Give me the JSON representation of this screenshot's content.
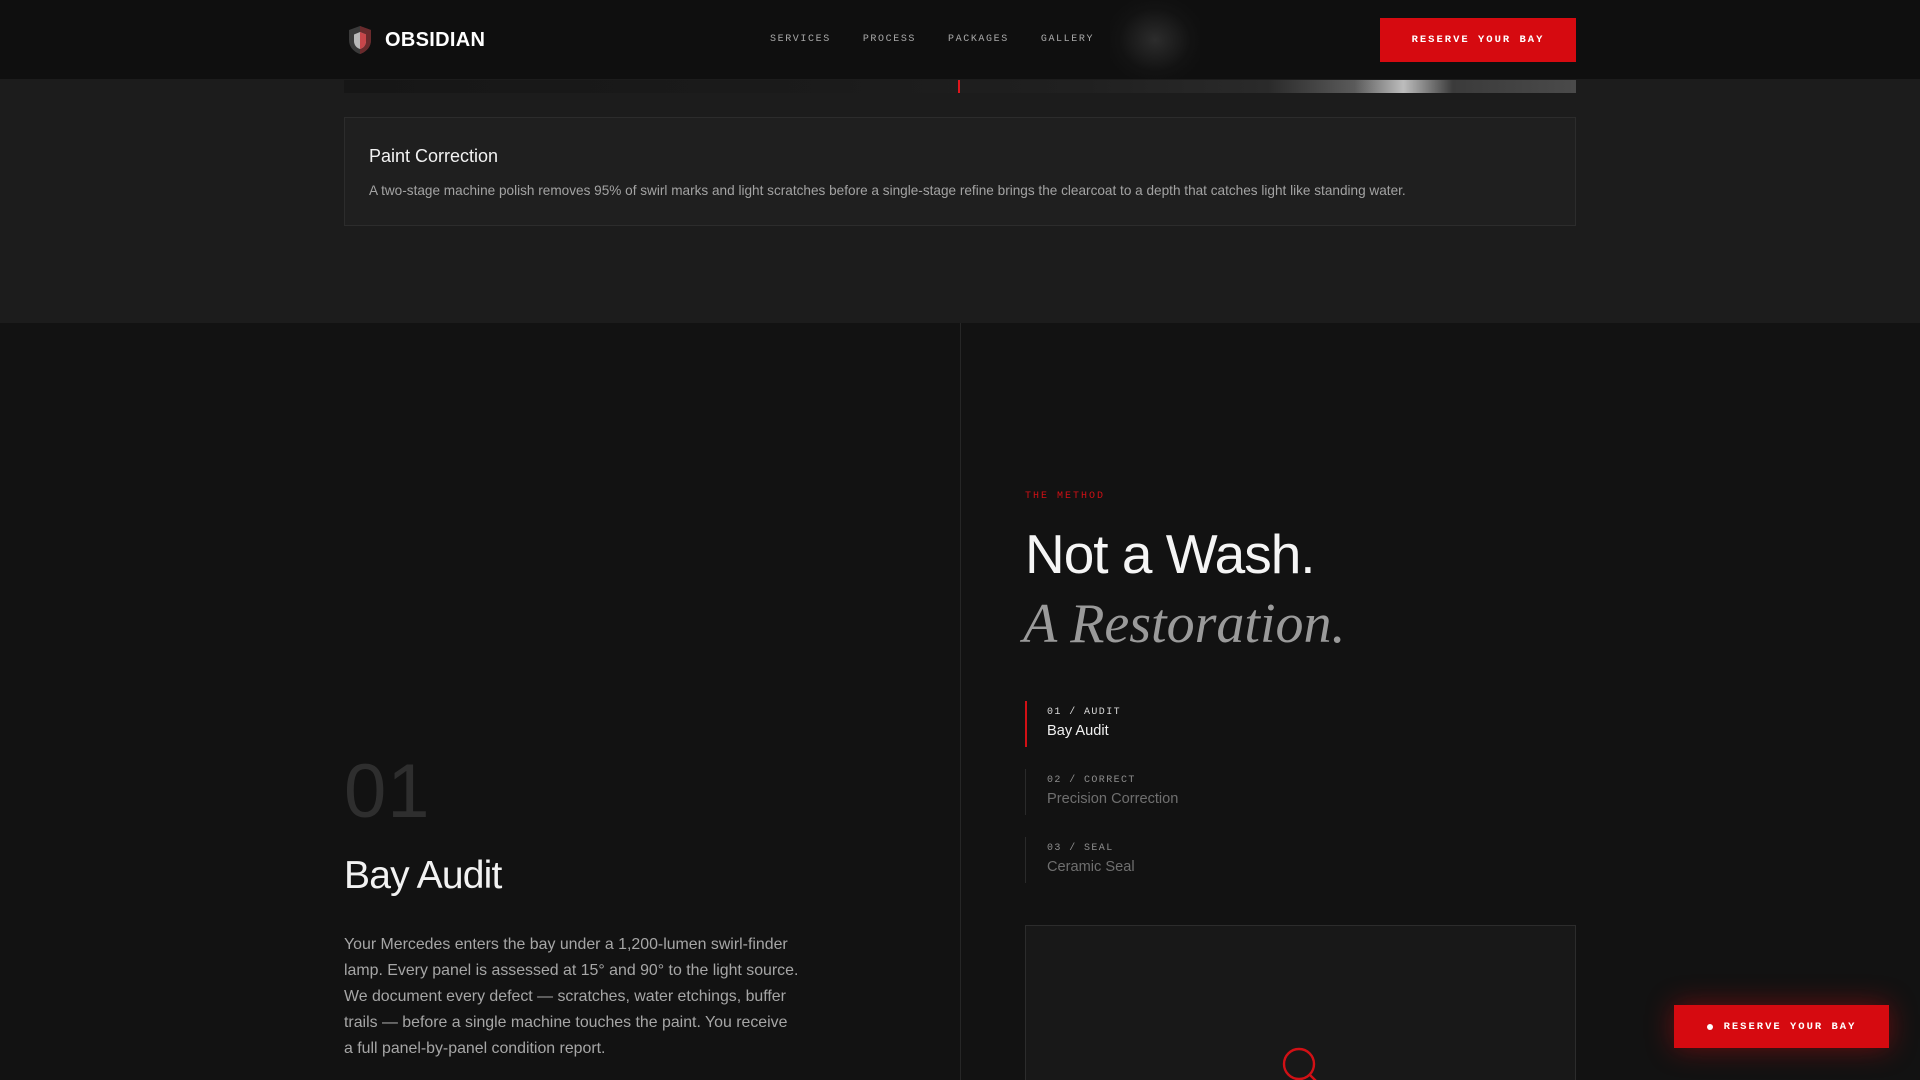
{
  "brand": {
    "name": "OBSIDIAN",
    "logo_icon": "shield-icon"
  },
  "nav": {
    "items": [
      {
        "label": "SERVICES"
      },
      {
        "label": "PROCESS"
      },
      {
        "label": "PACKAGES"
      },
      {
        "label": "GALLERY"
      }
    ],
    "cta_label": "RESERVE YOUR BAY"
  },
  "service": {
    "title": "Paint Correction",
    "description": "A two-stage machine polish removes 95% of swirl marks and light scratches before a single-stage refine brings the clearcoat to a depth that catches light like standing water."
  },
  "method": {
    "eyebrow": "THE METHOD",
    "headline_line1": "Not a Wash.",
    "headline_line2": "A Restoration.",
    "steps": [
      {
        "tag": "01 / AUDIT",
        "label": "Bay Audit",
        "active": true
      },
      {
        "tag": "02 / CORRECT",
        "label": "Precision Correction",
        "active": false
      },
      {
        "tag": "03 / SEAL",
        "label": "Ceramic Seal",
        "active": false
      }
    ],
    "preview_icon": "magnifier-icon"
  },
  "active_step": {
    "number": "01",
    "title": "Bay Audit",
    "body": "Your Mercedes enters the bay under a 1,200-lumen swirl-finder lamp. Every panel is assessed at 15° and 90° to the light source. We document every defect — scratches, water etchings, buffer trails — before a single machine touches the paint. You receive a full panel-by-panel condition report."
  },
  "floating_cta": {
    "label": "RESERVE YOUR BAY"
  },
  "colors": {
    "accent": "#d60a10",
    "background": "#121212",
    "panel": "#1c1c1c"
  }
}
